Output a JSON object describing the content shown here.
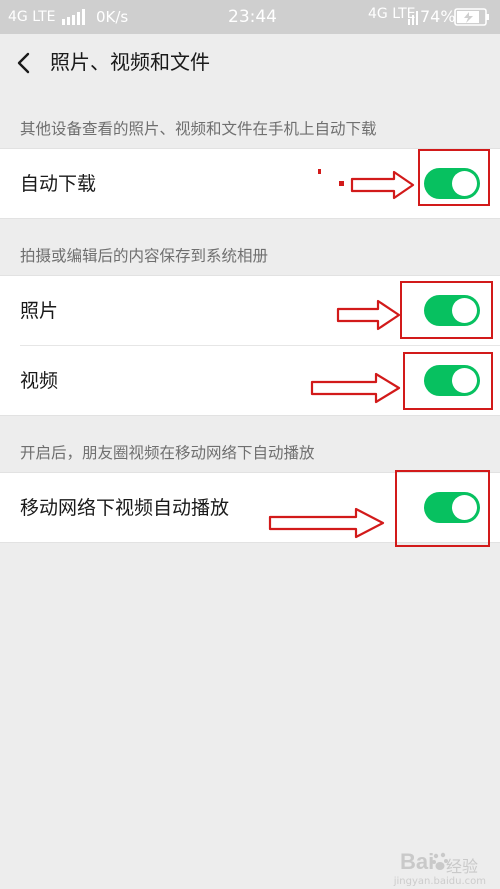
{
  "status_bar": {
    "network_left": "4G LTE",
    "speed": "0K/s",
    "time": "23:44",
    "network_right": "4G LTE",
    "battery": "74%"
  },
  "nav": {
    "title": "照片、视频和文件",
    "back_icon": "chevron-left-icon"
  },
  "sections": [
    {
      "header": "其他设备查看的照片、视频和文件在手机上自动下载",
      "items": [
        {
          "label": "自动下载",
          "enabled": true
        }
      ]
    },
    {
      "header": "拍摄或编辑后的内容保存到系统相册",
      "items": [
        {
          "label": "照片",
          "enabled": true
        },
        {
          "label": "视频",
          "enabled": true
        }
      ]
    },
    {
      "header": "开启后，朋友圈视频在移动网络下自动播放",
      "items": [
        {
          "label": "移动网络下视频自动播放",
          "enabled": true
        }
      ]
    }
  ],
  "watermark": {
    "brand": "Bai",
    "brand_cn": "经验",
    "url": "jingyan.baidu.com"
  },
  "colors": {
    "switch_on": "#07c160",
    "annotation": "#d21a1a",
    "page_bg": "#ededed"
  }
}
